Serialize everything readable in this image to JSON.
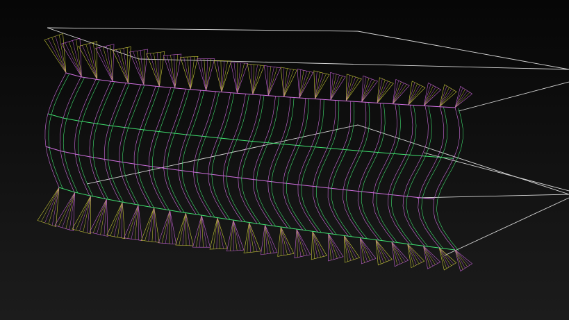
{
  "viewport": {
    "background_top": "#060606",
    "background_bottom": "#1c1c1c"
  },
  "colors": {
    "bounding_box": "#d8d8d8",
    "edge_magenta": "#d070e0",
    "edge_yellow": "#d8d040",
    "edge_green": "#40e070",
    "blade_yellow": "#c8c838",
    "blade_magenta": "#c060d0"
  },
  "mesh": {
    "segments": 26,
    "upper_blades": 26,
    "lower_blades": 26
  }
}
